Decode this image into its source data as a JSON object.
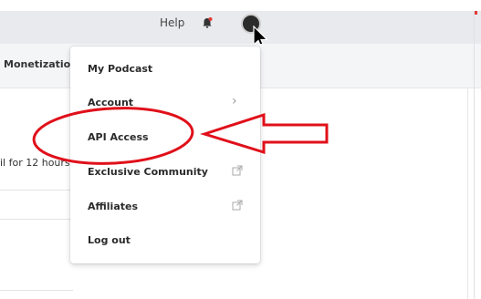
{
  "topbar": {
    "help_label": "Help"
  },
  "nav": {
    "tab_label": "Monetization"
  },
  "page": {
    "snippet_text": "il for 12 hours"
  },
  "menu": {
    "items": [
      {
        "label": "My Podcast",
        "icon": ""
      },
      {
        "label": "Account",
        "icon": "chevron-right-icon"
      },
      {
        "label": "API Access",
        "icon": ""
      },
      {
        "label": "Exclusive Community",
        "icon": "external-link-icon"
      },
      {
        "label": "Affiliates",
        "icon": "external-link-icon"
      },
      {
        "label": "Log out",
        "icon": ""
      }
    ],
    "chevron_glyph": "›"
  },
  "colors": {
    "topbar_bg": "#e9eaee",
    "annotation_red": "#e0101a",
    "notification_dot": "#e23b3b"
  },
  "annotation": {
    "shapes": [
      "ellipse-highlight",
      "arrow-pointing-left"
    ]
  }
}
